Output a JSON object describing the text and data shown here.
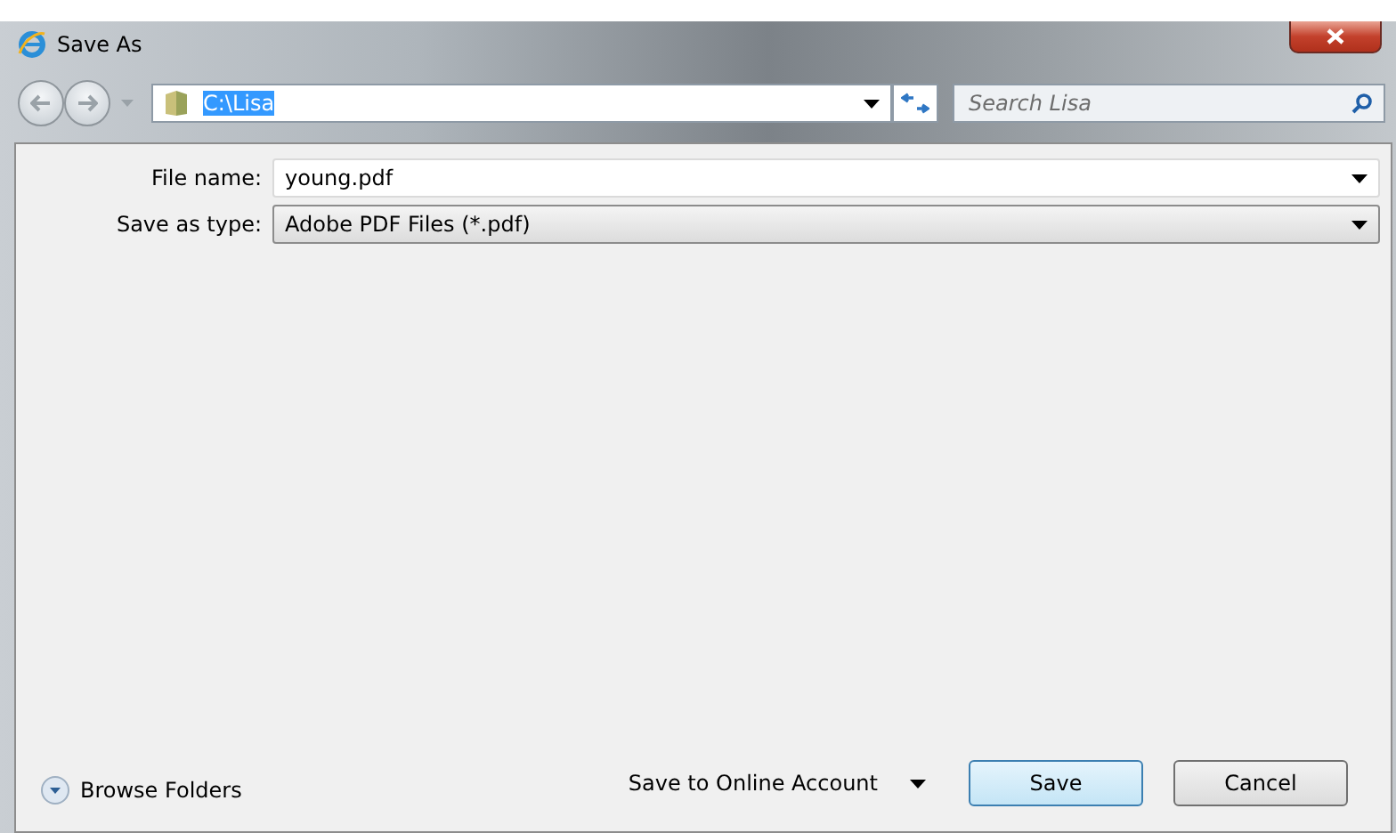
{
  "window": {
    "title": "Save As"
  },
  "address": {
    "path": "C:\\Lisa",
    "selected": true
  },
  "search": {
    "placeholder": "Search Lisa"
  },
  "fields": [
    {
      "label": "File name:",
      "value": "young.pdf",
      "kind": "editable"
    },
    {
      "label": "Save as type:",
      "value": "Adobe PDF Files (*.pdf)",
      "kind": "dropdown"
    }
  ],
  "browse_folders": {
    "label": "Browse Folders",
    "expanded": false
  },
  "online_account": {
    "label": "Save to Online Account"
  },
  "buttons": [
    {
      "label": "Save",
      "default": true
    },
    {
      "label": "Cancel",
      "default": false
    }
  ]
}
